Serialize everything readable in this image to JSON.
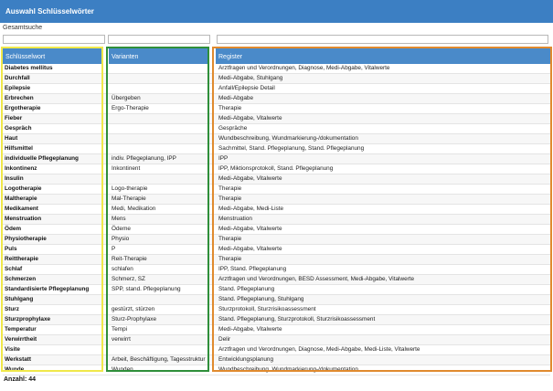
{
  "window": {
    "title": "Auswahl Schlüsselwörter"
  },
  "search": {
    "label": "Gesamtsuche",
    "filter_keyword": "",
    "filter_variants": "",
    "filter_register": ""
  },
  "columns": {
    "keyword": "Schlüsselwort",
    "variants": "Varianten",
    "register": "Register"
  },
  "rows": [
    {
      "keyword": "Diabetes mellitus",
      "variants": "",
      "register": "Arztfragen und Verordnungen, Diagnose, Medi-Abgabe, Vitalwerte"
    },
    {
      "keyword": "Durchfall",
      "variants": "",
      "register": "Medi-Abgabe, Stuhlgang"
    },
    {
      "keyword": "Epilepsie",
      "variants": "",
      "register": "Anfall/Epilepsie Detail"
    },
    {
      "keyword": "Erbrechen",
      "variants": "Übergeben",
      "register": "Medi-Abgabe"
    },
    {
      "keyword": "Ergotherapie",
      "variants": "Ergo-Therapie",
      "register": "Therapie"
    },
    {
      "keyword": "Fieber",
      "variants": "",
      "register": "Medi-Abgabe, Vitalwerte"
    },
    {
      "keyword": "Gespräch",
      "variants": "",
      "register": "Gespräche"
    },
    {
      "keyword": "Haut",
      "variants": "",
      "register": "Wundbeschreibung, Wundmarkierung-/dokumentation"
    },
    {
      "keyword": "Hilfsmittel",
      "variants": "",
      "register": "Sachmittel, Stand. Pflegeplanung, Stand. Pflegeplanung"
    },
    {
      "keyword": "individuelle Pflegeplanung",
      "variants": "indiv. Pflegeplanung, IPP",
      "register": "IPP"
    },
    {
      "keyword": "Inkontinenz",
      "variants": "Inkontinent",
      "register": "IPP, Miktionsprotokoll, Stand. Pflegeplanung"
    },
    {
      "keyword": "Insulin",
      "variants": "",
      "register": "Medi-Abgabe, Vitalwerte"
    },
    {
      "keyword": "Logotherapie",
      "variants": "Logo-therapie",
      "register": "Therapie"
    },
    {
      "keyword": "Maltherapie",
      "variants": "Mal-Therapie",
      "register": "Therapie"
    },
    {
      "keyword": "Medikament",
      "variants": "Medi, Medikation",
      "register": "Medi-Abgabe, Medi-Liste"
    },
    {
      "keyword": "Menstruation",
      "variants": "Mens",
      "register": "Menstruation"
    },
    {
      "keyword": "Ödem",
      "variants": "Ödeme",
      "register": "Medi-Abgabe, Vitalwerte"
    },
    {
      "keyword": "Physiotherapie",
      "variants": "Physio",
      "register": "Therapie"
    },
    {
      "keyword": "Puls",
      "variants": "P",
      "register": "Medi-Abgabe, Vitalwerte"
    },
    {
      "keyword": "Reittherapie",
      "variants": "Reit-Therapie",
      "register": "Therapie"
    },
    {
      "keyword": "Schlaf",
      "variants": "schlafen",
      "register": "IPP, Stand. Pflegeplanung"
    },
    {
      "keyword": "Schmerzen",
      "variants": "Schmerz, SZ",
      "register": "Arztfragen und Verordnungen, BESD Assessment, Medi-Abgabe, Vitalwerte"
    },
    {
      "keyword": "Standardisierte Pflegeplanung",
      "variants": "SPP, stand. Pflegeplanung",
      "register": "Stand. Pflegeplanung"
    },
    {
      "keyword": "Stuhlgang",
      "variants": "",
      "register": "Stand. Pflegeplanung, Stuhlgang"
    },
    {
      "keyword": "Sturz",
      "variants": "gestürzt, stürzen",
      "register": "Sturzprotokoll, Sturzrisikoassessment"
    },
    {
      "keyword": "Sturzprophylaxe",
      "variants": "Sturz-Prophylaxe",
      "register": "Stand. Pflegeplanung, Sturzprotokoll, Sturzrisikoassessment"
    },
    {
      "keyword": "Temperatur",
      "variants": "Tempi",
      "register": "Medi-Abgabe, Vitalwerte"
    },
    {
      "keyword": "Verwirrtheit",
      "variants": "verwirrt",
      "register": "Delir"
    },
    {
      "keyword": "Visite",
      "variants": "",
      "register": "Arztfragen und Verordnungen, Diagnose, Medi-Abgabe, Medi-Liste, Vitalwerte"
    },
    {
      "keyword": "Werkstatt",
      "variants": "Arbeit, Beschäftigung, Tagesstruktur",
      "register": "Entwicklungsplanung"
    },
    {
      "keyword": "Wunde",
      "variants": "Wunden",
      "register": "Wundbeschreibung, Wundmarkierung-/dokumentation"
    }
  ],
  "footer": {
    "count_label": "Anzahl: 44"
  },
  "colors": {
    "titlebar": "#3c7fc3",
    "header": "#4a8ac9",
    "highlight_keyword": "#f0e84a",
    "highlight_variants": "#2f8f3a",
    "highlight_register": "#e08a2e"
  }
}
